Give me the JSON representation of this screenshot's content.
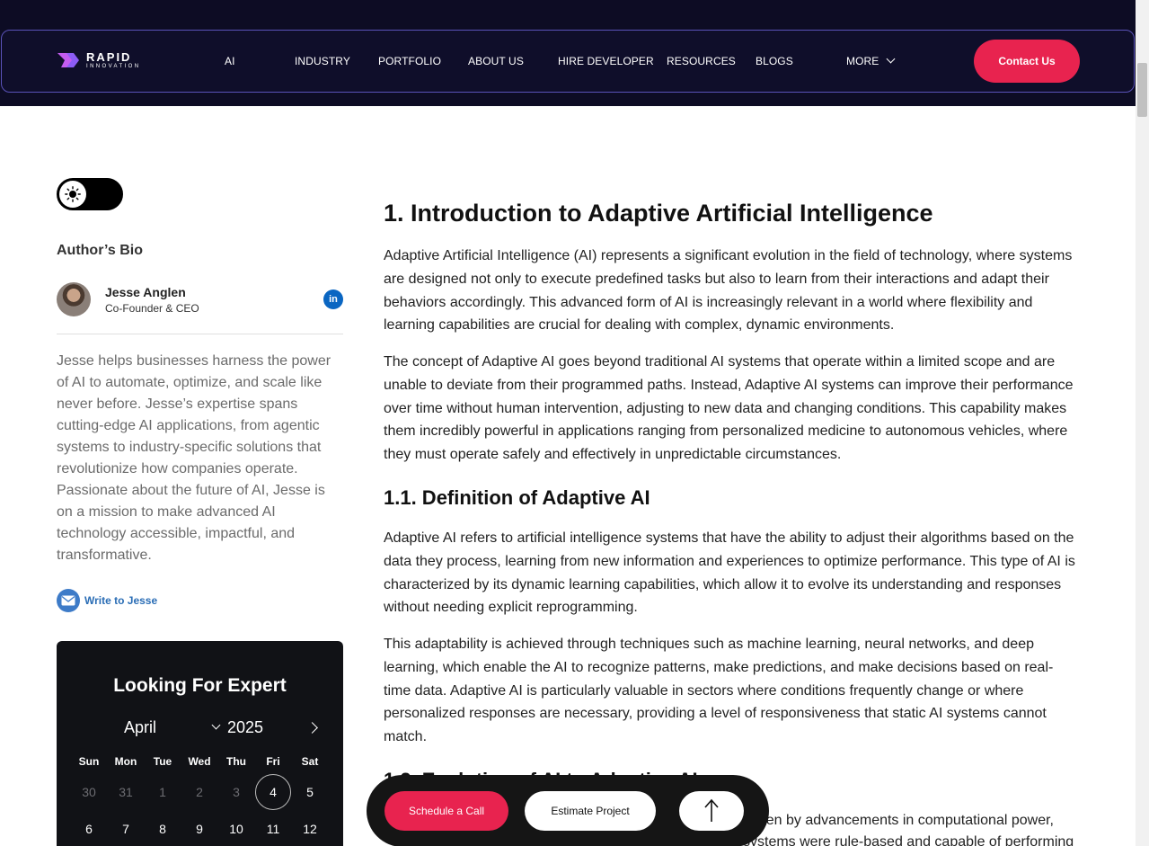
{
  "brand": {
    "name": "RAPID",
    "tagline": "INNOVATION",
    "accent": "#e8234f",
    "nav_bg": "#0f0e2a"
  },
  "nav": {
    "items": [
      "AI",
      "INDUSTRY",
      "PORTFOLIO",
      "ABOUT US",
      "HIRE DEVELOPER",
      "RESOURCES",
      "BLOGS",
      "MORE"
    ],
    "contact_label": "Contact Us"
  },
  "sidebar": {
    "theme_toggle_icon": "sun-icon",
    "bio_title": "Author’s Bio",
    "author": {
      "name": "Jesse Anglen",
      "role": "Co-Founder & CEO"
    },
    "linkedin_label": "in",
    "bio": "Jesse helps businesses harness the power of AI to automate, optimize, and scale like never before. Jesse’s expertise spans cutting-edge AI applications, from agentic systems to industry-specific solutions that revolutionize how companies operate. Passionate about the future of AI, Jesse is on a mission to make advanced AI technology accessible, impactful, and transformative.",
    "write_label": "Write to Jesse"
  },
  "calendar": {
    "title": "Looking For Expert",
    "month": "April",
    "year": "2025",
    "weekdays": [
      "Sun",
      "Mon",
      "Tue",
      "Wed",
      "Thu",
      "Fri",
      "Sat"
    ],
    "week1": [
      "30",
      "31",
      "1",
      "2",
      "3",
      "4",
      "5"
    ],
    "week1_muted": [
      true,
      true,
      true,
      true,
      true,
      false,
      false
    ],
    "week2": [
      "6",
      "7",
      "8",
      "9",
      "10",
      "11",
      "12"
    ],
    "today": "4"
  },
  "article": {
    "h1": "1. Introduction to Adaptive Artificial Intelligence",
    "p1": "Adaptive Artificial Intelligence (AI) represents a significant evolution in the field of technology, where systems are designed not only to execute predefined tasks but also to learn from their interactions and adapt their behaviors accordingly. This advanced form of AI is increasingly relevant in a world where flexibility and learning capabilities are crucial for dealing with complex, dynamic environments.",
    "p2": "The concept of Adaptive AI goes beyond traditional AI systems that operate within a limited scope and are unable to deviate from their programmed paths. Instead, Adaptive AI systems can improve their performance over time without human intervention, adjusting to new data and changing conditions. This capability makes them incredibly powerful in applications ranging from personalized medicine to autonomous vehicles, where they must operate safely and effectively in unpredictable circumstances.",
    "h2a": "1.1. Definition of Adaptive AI",
    "p3": "Adaptive AI refers to artificial intelligence systems that have the ability to adjust their algorithms based on the data they process, learning from new information and experiences to optimize performance. This type of AI is characterized by its dynamic learning capabilities, which allow it to evolve its understanding and responses without needing explicit reprogramming.",
    "p4": "This adaptability is achieved through techniques such as machine learning, neural networks, and deep learning, which enable the AI to recognize patterns, make predictions, and make decisions based on real-time data. Adaptive AI is particularly valuable in sectors where conditions frequently change or where personalized responses are necessary, providing a level of responsiveness that static AI systems cannot match.",
    "h2b": "1.2. Evolution of AI to Adaptive AI",
    "p5_visible": "driven by advancements in computational power,",
    "p5_line2": "systems were rule-based and capable of performing"
  },
  "action_bar": {
    "schedule_label": "Schedule a Call",
    "estimate_label": "Estimate Project",
    "top_icon": "arrow-up-icon"
  }
}
